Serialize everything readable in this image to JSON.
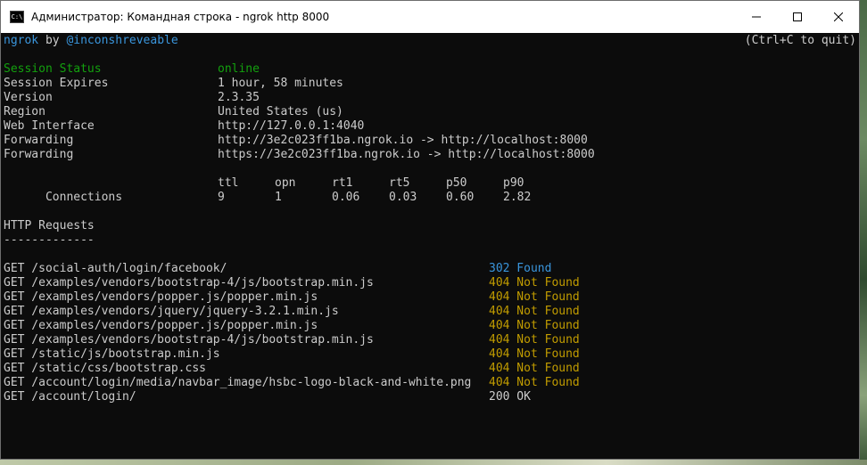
{
  "window": {
    "title": "Администратор: Командная строка - ngrok  http 8000",
    "icon_label": "C:\\"
  },
  "header": {
    "app": "ngrok",
    "by": " by ",
    "author": "@inconshreveable",
    "quit_hint": "(Ctrl+C to quit)"
  },
  "session": {
    "rows": [
      {
        "label": "Session Status",
        "value": "online"
      },
      {
        "label": "Session Expires",
        "value": "1 hour, 58 minutes"
      },
      {
        "label": "Version",
        "value": "2.3.35"
      },
      {
        "label": "Region",
        "value": "United States (us)"
      },
      {
        "label": "Web Interface",
        "value": "http://127.0.0.1:4040"
      },
      {
        "label": "Forwarding",
        "value": "http://3e2c023ff1ba.ngrok.io -> http://localhost:8000"
      },
      {
        "label": "Forwarding",
        "value": "https://3e2c023ff1ba.ngrok.io -> http://localhost:8000"
      }
    ]
  },
  "connections": {
    "label": "Connections",
    "headers": [
      "ttl",
      "opn",
      "rt1",
      "rt5",
      "p50",
      "p90"
    ],
    "values": [
      "9",
      "1",
      "0.06",
      "0.03",
      "0.60",
      "2.82"
    ]
  },
  "http_requests": {
    "title": "HTTP Requests",
    "underline": "-------------",
    "rows": [
      {
        "request": "GET /social-auth/login/facebook/",
        "status": "302 Found"
      },
      {
        "request": "GET /examples/vendors/bootstrap-4/js/bootstrap.min.js",
        "status": "404 Not Found"
      },
      {
        "request": "GET /examples/vendors/popper.js/popper.min.js",
        "status": "404 Not Found"
      },
      {
        "request": "GET /examples/vendors/jquery/jquery-3.2.1.min.js",
        "status": "404 Not Found"
      },
      {
        "request": "GET /examples/vendors/popper.js/popper.min.js",
        "status": "404 Not Found"
      },
      {
        "request": "GET /examples/vendors/bootstrap-4/js/bootstrap.min.js",
        "status": "404 Not Found"
      },
      {
        "request": "GET /static/js/bootstrap.min.js",
        "status": "404 Not Found"
      },
      {
        "request": "GET /static/css/bootstrap.css",
        "status": "404 Not Found"
      },
      {
        "request": "GET /account/login/media/navbar_image/hsbc-logo-black-and-white.png",
        "status": "404 Not Found"
      },
      {
        "request": "GET /account/login/",
        "status": "200 OK"
      }
    ]
  },
  "colors": {
    "console_bg": "#0c0c0c",
    "text": "#cccccc",
    "online": "#13a10e",
    "redirect": "#3a96dd",
    "not_found": "#c19c00",
    "author": "#3a96dd"
  }
}
